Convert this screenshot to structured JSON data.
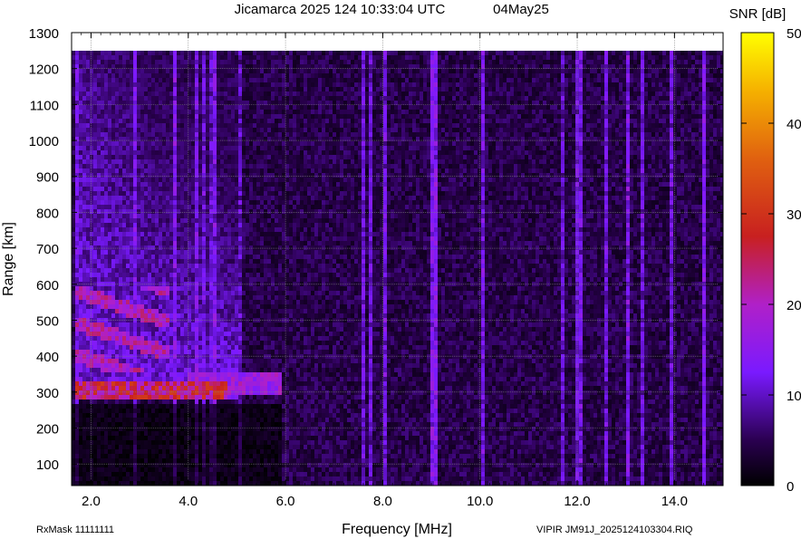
{
  "title": "Jicamarca 2025 124 10:33:04 UTC",
  "date_label": "04May25",
  "footer": {
    "rxmask": "RxMask 11111111",
    "file": "VIPIR  JM91J_2025124103304.RIQ"
  },
  "chart_data": {
    "type": "heatmap",
    "title": "Jicamarca 2025 124 10:33:04 UTC",
    "xlabel": "Frequency [MHz]",
    "ylabel": "Range [km]",
    "xlim": [
      1.6,
      15.0
    ],
    "ylim": [
      40,
      1300
    ],
    "x_ticks": [
      2.0,
      4.0,
      6.0,
      8.0,
      10.0,
      12.0,
      14.0
    ],
    "x_tick_labels": [
      "2.0",
      "4.0",
      "6.0",
      "8.0",
      "10.0",
      "12.0",
      "14.0"
    ],
    "y_ticks": [
      100,
      200,
      300,
      400,
      500,
      600,
      700,
      800,
      900,
      1000,
      1100,
      1200,
      1300
    ],
    "y_tick_labels": [
      "100",
      "200",
      "300",
      "400",
      "500",
      "600",
      "700",
      "800",
      "900",
      "1000",
      "1100",
      "1200",
      "1300"
    ],
    "colorbar": {
      "label": "SNR [dB]",
      "range": [
        0,
        50
      ],
      "ticks": [
        0,
        10,
        20,
        30,
        40,
        50
      ],
      "tick_labels": [
        "0",
        "10",
        "20",
        "30",
        "40",
        "50"
      ]
    },
    "data_top_range_km": 1245,
    "grid": true,
    "features": [
      {
        "name": "o-trace base",
        "freq_range_mhz": [
          1.7,
          4.8
        ],
        "range_km": [
          280,
          330
        ],
        "snr_db": 26
      },
      {
        "name": "x-trace base",
        "freq_range_mhz": [
          4.0,
          5.9
        ],
        "range_km": [
          290,
          360
        ],
        "snr_db": 18
      },
      {
        "name": "oblique arcs",
        "freq_range_mhz": [
          1.7,
          3.6
        ],
        "range_km": [
          360,
          600
        ],
        "snr_db": 22
      },
      {
        "name": "diffuse spread",
        "freq_range_mhz": [
          1.7,
          5.0
        ],
        "range_km": [
          280,
          1245
        ],
        "snr_db": 12
      }
    ]
  }
}
